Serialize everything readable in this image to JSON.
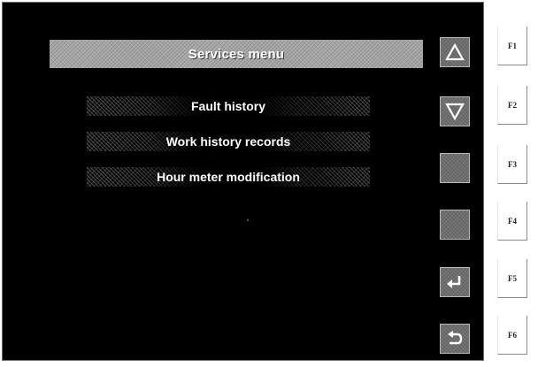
{
  "header": {
    "title": "Services menu"
  },
  "menu": {
    "items": [
      {
        "label": "Fault history"
      },
      {
        "label": "Work history records"
      },
      {
        "label": "Hour meter modification"
      }
    ]
  },
  "softkeys": [
    {
      "icon": "up-triangle-icon"
    },
    {
      "icon": "down-triangle-icon"
    },
    {
      "icon": "blank"
    },
    {
      "icon": "blank"
    },
    {
      "icon": "enter-arrow-icon"
    },
    {
      "icon": "back-arrow-icon"
    }
  ],
  "function_keys": [
    {
      "label": "F1"
    },
    {
      "label": "F2"
    },
    {
      "label": "F3"
    },
    {
      "label": "F4"
    },
    {
      "label": "F5"
    },
    {
      "label": "F6"
    }
  ],
  "colors": {
    "screen_background": "#000000",
    "header_bar": "#a6a6a6",
    "text": "#ffffff",
    "key_face": "#6e6e6e"
  }
}
